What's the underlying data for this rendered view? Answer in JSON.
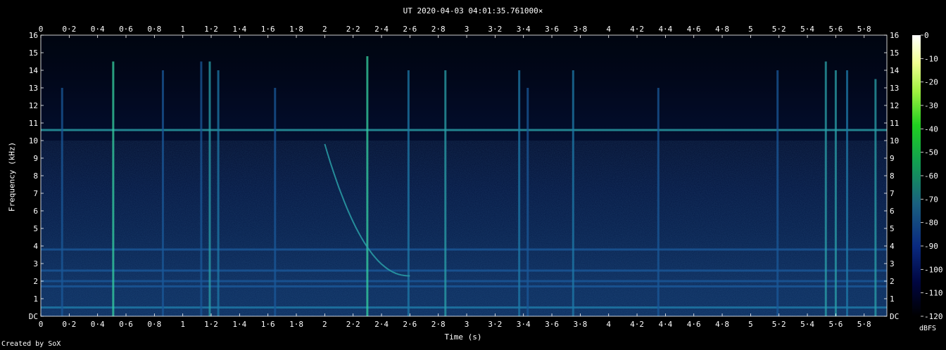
{
  "chart_data": {
    "type": "heatmap",
    "title": "UT 2020-04-03 04:01:35.761000×",
    "xlabel": "Time (s)",
    "ylabel": "Frequency (kHz)",
    "colorbar_label": "dBFS",
    "credit": "Created by SoX",
    "xlim": [
      0,
      5.96
    ],
    "ylim": [
      0,
      16
    ],
    "x_ticks": [
      "0",
      "0·2",
      "0·4",
      "0·6",
      "0·8",
      "1",
      "1·2",
      "1·4",
      "1·6",
      "1·8",
      "2",
      "2·2",
      "2·4",
      "2·6",
      "2·8",
      "3",
      "3·2",
      "3·4",
      "3·6",
      "3·8",
      "4",
      "4·2",
      "4·4",
      "4·6",
      "4·8",
      "5",
      "5·2",
      "5·4",
      "5·6",
      "5·8"
    ],
    "x_tick_values": [
      0,
      0.2,
      0.4,
      0.6,
      0.8,
      1.0,
      1.2,
      1.4,
      1.6,
      1.8,
      2.0,
      2.2,
      2.4,
      2.6,
      2.8,
      3.0,
      3.2,
      3.4,
      3.6,
      3.8,
      4.0,
      4.2,
      4.4,
      4.6,
      4.8,
      5.0,
      5.2,
      5.4,
      5.6,
      5.8
    ],
    "y_ticks": [
      "DC",
      "1",
      "2",
      "3",
      "4",
      "5",
      "6",
      "7",
      "8",
      "9",
      "10",
      "11",
      "12",
      "13",
      "14",
      "15",
      "16"
    ],
    "colorbar_ticks": [
      "0",
      "-10",
      "-20",
      "-30",
      "-40",
      "-50",
      "-60",
      "-70",
      "-80",
      "-90",
      "-100",
      "-110",
      "-120"
    ],
    "colorbar_range_dbfs": [
      -120,
      0
    ],
    "horizontal_bands_khz": [
      {
        "freq": 10.6,
        "level_dbfs": -85
      },
      {
        "freq": 2.0,
        "level_dbfs": -95
      },
      {
        "freq": 1.7,
        "level_dbfs": -95
      },
      {
        "freq": 3.8,
        "level_dbfs": -100
      },
      {
        "freq": 2.6,
        "level_dbfs": -100
      },
      {
        "freq": 0.5,
        "level_dbfs": -90
      }
    ],
    "vertical_transients_s": [
      {
        "t": 0.15,
        "fmax": 13,
        "level_dbfs": -95
      },
      {
        "t": 0.51,
        "fmax": 14.5,
        "level_dbfs": -75
      },
      {
        "t": 0.86,
        "fmax": 14,
        "level_dbfs": -95
      },
      {
        "t": 1.13,
        "fmax": 14.5,
        "level_dbfs": -95
      },
      {
        "t": 1.19,
        "fmax": 14.5,
        "level_dbfs": -85
      },
      {
        "t": 1.25,
        "fmax": 14,
        "level_dbfs": -90
      },
      {
        "t": 1.65,
        "fmax": 13,
        "level_dbfs": -95
      },
      {
        "t": 2.3,
        "fmax": 14.8,
        "level_dbfs": -75
      },
      {
        "t": 2.59,
        "fmax": 14,
        "level_dbfs": -90
      },
      {
        "t": 2.85,
        "fmax": 14,
        "level_dbfs": -85
      },
      {
        "t": 3.37,
        "fmax": 14,
        "level_dbfs": -90
      },
      {
        "t": 3.43,
        "fmax": 13,
        "level_dbfs": -95
      },
      {
        "t": 3.75,
        "fmax": 14,
        "level_dbfs": -90
      },
      {
        "t": 4.35,
        "fmax": 13,
        "level_dbfs": -95
      },
      {
        "t": 5.19,
        "fmax": 14,
        "level_dbfs": -95
      },
      {
        "t": 5.53,
        "fmax": 14.5,
        "level_dbfs": -80
      },
      {
        "t": 5.6,
        "fmax": 14,
        "level_dbfs": -85
      },
      {
        "t": 5.68,
        "fmax": 14,
        "level_dbfs": -90
      },
      {
        "t": 5.88,
        "fmax": 13.5,
        "level_dbfs": -85
      }
    ],
    "sweep": {
      "t_start": 2.0,
      "f_start_khz": 9.8,
      "t_end": 2.6,
      "f_end_khz": 2.3,
      "level_dbfs": -85
    }
  }
}
